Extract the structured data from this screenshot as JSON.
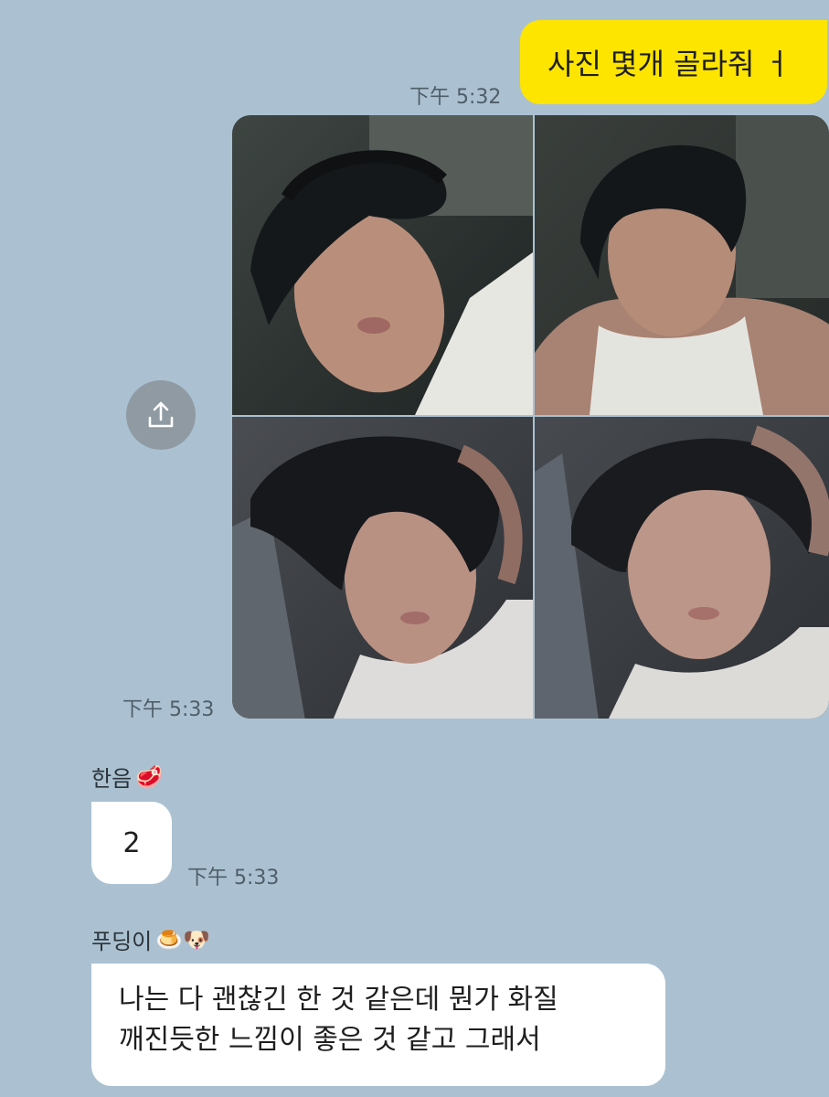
{
  "messages": {
    "sent_1": {
      "text": "사진 몇개 골라줘 ㅓ",
      "time": "下午 5:32"
    },
    "photos": {
      "time": "下午 5:33",
      "share_icon": "share-upload-icon"
    },
    "received_1": {
      "sender": "한음",
      "sender_emoji": "🥩",
      "text": "2",
      "time": "下午 5:33"
    },
    "received_2": {
      "sender": "푸딩이",
      "sender_emoji": "🍮🐶",
      "text_line_1": "나는 다 괜찮긴 한 것 같은데 뭔가 화질",
      "text_line_2": "깨진듯한 느낌이 좋은 것 같고 그래서"
    }
  },
  "colors": {
    "background": "#abc1d1",
    "sent_bubble": "#fee500",
    "received_bubble": "#ffffff",
    "timestamp": "#4f5d68"
  }
}
